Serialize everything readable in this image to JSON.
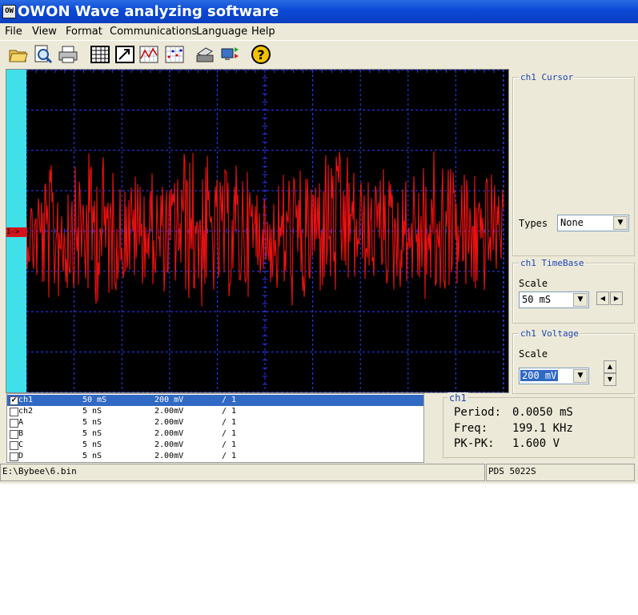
{
  "window": {
    "title": "OWON Wave analyzing software",
    "icon": "owon-app-icon",
    "icon_text": "OW"
  },
  "menu": [
    "File",
    "View",
    "Format",
    "Communications",
    "Language",
    "Help"
  ],
  "toolbar": [
    "open-folder-icon",
    "zoom-search-icon",
    "print-icon",
    "grid-table-icon",
    "export-icon",
    "waveform-chart-icon",
    "point-chart-icon",
    "printer-setup-icon",
    "communication-icon",
    "help-icon"
  ],
  "scope": {
    "marker": "1->",
    "wave_color": "#ee1111",
    "grid_color": "#2a3cff",
    "background": "#000000"
  },
  "cursor_panel": {
    "title": "ch1 Cursor",
    "types_label": "Types",
    "types_value": "None"
  },
  "timebase_panel": {
    "title": "ch1 TimeBase",
    "scale_label": "Scale",
    "scale_value": "50 mS"
  },
  "voltage_panel": {
    "title": "ch1 Voltage",
    "scale_label": "Scale",
    "scale_value": "200 mV"
  },
  "channels": [
    {
      "name": "ch1",
      "time": "50  mS",
      "volt": "200 mV",
      "ratio": "/ 1",
      "checked": true
    },
    {
      "name": "ch2",
      "time": "5   nS",
      "volt": "2.00mV",
      "ratio": "/ 1",
      "checked": false
    },
    {
      "name": "A",
      "time": "5   nS",
      "volt": "2.00mV",
      "ratio": "/ 1",
      "checked": false
    },
    {
      "name": "B",
      "time": "5   nS",
      "volt": "2.00mV",
      "ratio": "/ 1",
      "checked": false
    },
    {
      "name": "C",
      "time": "5   nS",
      "volt": "2.00mV",
      "ratio": "/ 1",
      "checked": false
    },
    {
      "name": "D",
      "time": "5   nS",
      "volt": "2.00mV",
      "ratio": "/ 1",
      "checked": false
    }
  ],
  "measurements": {
    "title": "ch1",
    "period_label": "Period:",
    "period_value": "0.0050 mS",
    "freq_label": "Freq:",
    "freq_value": "199.1 KHz",
    "pkpk_label": "PK-PK:",
    "pkpk_value": "1.600 V"
  },
  "status": {
    "file_path": "E:\\Bybee\\6.bin",
    "device": "PDS 5022S"
  }
}
